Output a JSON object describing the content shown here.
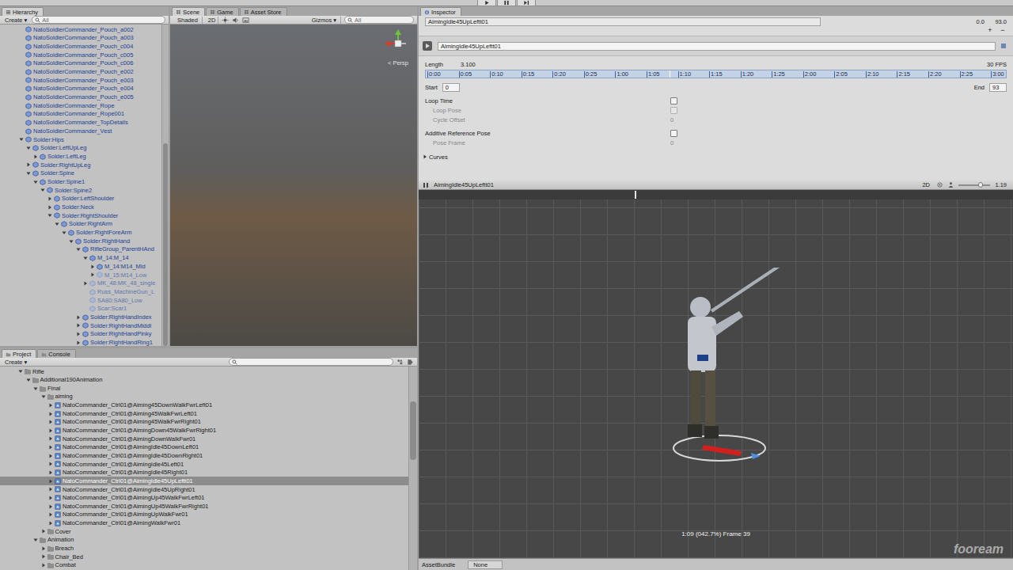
{
  "hierarchy": {
    "tab": "Hierarchy",
    "create": "Create ▾",
    "search": "All",
    "scrollbar": {
      "offset": 0.37,
      "size": 0.63
    },
    "items": [
      {
        "label": "NatoSoldierCommander_Pouch_a002",
        "depth": 1,
        "has_children": false,
        "expanded": false,
        "active": true
      },
      {
        "label": "NatoSoldierCommander_Pouch_a003",
        "depth": 1,
        "has_children": false,
        "expanded": false,
        "active": true
      },
      {
        "label": "NatoSoldierCommander_Pouch_c004",
        "depth": 1,
        "has_children": false,
        "expanded": false,
        "active": true
      },
      {
        "label": "NatoSoldierCommander_Pouch_c005",
        "depth": 1,
        "has_children": false,
        "expanded": false,
        "active": true
      },
      {
        "label": "NatoSoldierCommander_Pouch_c006",
        "depth": 1,
        "has_children": false,
        "expanded": false,
        "active": true
      },
      {
        "label": "NatoSoldierCommander_Pouch_e002",
        "depth": 1,
        "has_children": false,
        "expanded": false,
        "active": true
      },
      {
        "label": "NatoSoldierCommander_Pouch_e003",
        "depth": 1,
        "has_children": false,
        "expanded": false,
        "active": true
      },
      {
        "label": "NatoSoldierCommander_Pouch_e004",
        "depth": 1,
        "has_children": false,
        "expanded": false,
        "active": true
      },
      {
        "label": "NatoSoldierCommander_Pouch_e005",
        "depth": 1,
        "has_children": false,
        "expanded": false,
        "active": true
      },
      {
        "label": "NatoSoldierCommander_Rope",
        "depth": 1,
        "has_children": false,
        "expanded": false,
        "active": true
      },
      {
        "label": "NatoSoldierCommander_Rope001",
        "depth": 1,
        "has_children": false,
        "expanded": false,
        "active": true
      },
      {
        "label": "NatoSoldierCommander_TopDetails",
        "depth": 1,
        "has_children": false,
        "expanded": false,
        "active": true
      },
      {
        "label": "NatoSoldierCommander_Vest",
        "depth": 1,
        "has_children": false,
        "expanded": false,
        "active": true
      },
      {
        "label": "Solder:Hips",
        "depth": 1,
        "has_children": true,
        "expanded": true,
        "active": true
      },
      {
        "label": "Solder:LeftUpLeg",
        "depth": 2,
        "has_children": true,
        "expanded": true,
        "active": true
      },
      {
        "label": "Solder:LeftLeg",
        "depth": 3,
        "has_children": true,
        "expanded": false,
        "active": true
      },
      {
        "label": "Solder:RightUpLeg",
        "depth": 2,
        "has_children": true,
        "expanded": false,
        "active": true
      },
      {
        "label": "Solder:Spine",
        "depth": 2,
        "has_children": true,
        "expanded": true,
        "active": true
      },
      {
        "label": "Solder:Spine1",
        "depth": 3,
        "has_children": true,
        "expanded": true,
        "active": true
      },
      {
        "label": "Solder:Spine2",
        "depth": 4,
        "has_children": true,
        "expanded": true,
        "active": true
      },
      {
        "label": "Solder:LeftShoulder",
        "depth": 5,
        "has_children": true,
        "expanded": false,
        "active": true
      },
      {
        "label": "Solder:Neck",
        "depth": 5,
        "has_children": true,
        "expanded": false,
        "active": true
      },
      {
        "label": "Solder:RightShoulder",
        "depth": 5,
        "has_children": true,
        "expanded": true,
        "active": true
      },
      {
        "label": "Solder:RightArm",
        "depth": 6,
        "has_children": true,
        "expanded": true,
        "active": true
      },
      {
        "label": "Solder:RightForeArm",
        "depth": 7,
        "has_children": true,
        "expanded": true,
        "active": true
      },
      {
        "label": "Solder:RightHand",
        "depth": 8,
        "has_children": true,
        "expanded": true,
        "active": true
      },
      {
        "label": "RifleGroup_ParentHAnd",
        "depth": 9,
        "has_children": true,
        "expanded": true,
        "active": true
      },
      {
        "label": "M_14:M_14",
        "depth": 10,
        "has_children": true,
        "expanded": true,
        "active": true
      },
      {
        "label": "M_14:M14_Mid",
        "depth": 11,
        "has_children": true,
        "expanded": false,
        "active": true
      },
      {
        "label": "M_15:M14_Low",
        "depth": 11,
        "has_children": true,
        "expanded": false,
        "active": false
      },
      {
        "label": "MK_48:MK_48_single",
        "depth": 10,
        "has_children": true,
        "expanded": false,
        "active": false
      },
      {
        "label": "Russ_MachineGun_L",
        "depth": 10,
        "has_children": false,
        "expanded": false,
        "active": false
      },
      {
        "label": "SA80:SA80_Low",
        "depth": 10,
        "has_children": false,
        "expanded": false,
        "active": false
      },
      {
        "label": "Scar:Scar1",
        "depth": 10,
        "has_children": false,
        "expanded": false,
        "active": false
      },
      {
        "label": "Solder:RightHandIndex",
        "depth": 9,
        "has_children": true,
        "expanded": false,
        "active": true
      },
      {
        "label": "Solder:RightHandMiddl",
        "depth": 9,
        "has_children": true,
        "expanded": false,
        "active": true
      },
      {
        "label": "Solder:RightHandPinky",
        "depth": 9,
        "has_children": true,
        "expanded": false,
        "active": true
      },
      {
        "label": "Solder:RightHandRing1",
        "depth": 9,
        "has_children": true,
        "expanded": false,
        "active": true
      }
    ]
  },
  "scene": {
    "tabs": [
      {
        "label": "Scene",
        "selected": true
      },
      {
        "label": "Game",
        "selected": false
      },
      {
        "label": "Asset Store",
        "selected": false
      }
    ],
    "shading": "Shaded",
    "mode_2d": "2D",
    "gizmos": "Gizmos ▾",
    "search": "All",
    "persp": "< Persp"
  },
  "inspector": {
    "tab": "Inspector",
    "name": "AimingIdle45UpLeftt01",
    "range_start": "0.0",
    "range_end": "93.0",
    "add": "+",
    "remove": "−",
    "clip_name": "AimingIdle45UpLeftt01",
    "length_label": "Length",
    "length": "3.100",
    "fps": "30 FPS",
    "ticks": [
      "0:00",
      "0:05",
      "0:10",
      "0:15",
      "0:20",
      "0:25",
      "1:00",
      "1:05",
      "1:10",
      "1:15",
      "1:20",
      "1:25",
      "2:00",
      "2:05",
      "2:10",
      "2:15",
      "2:20",
      "2:25",
      "3:00"
    ],
    "playhead": 0.42,
    "start_label": "Start",
    "start": "0",
    "end_label": "End",
    "end": "93",
    "settings": [
      {
        "label": "Loop Time",
        "kind": "checkbox",
        "checked": false,
        "disabled": false,
        "value": ""
      },
      {
        "label": "Loop Pose",
        "kind": "checkbox",
        "checked": false,
        "disabled": true,
        "value": ""
      },
      {
        "label": "Cycle Offset",
        "kind": "number",
        "checked": false,
        "disabled": true,
        "value": "0"
      },
      {
        "label": "Additive Reference Pose",
        "kind": "checkbox",
        "checked": false,
        "disabled": false,
        "value": ""
      },
      {
        "label": "Pose Frame",
        "kind": "number",
        "checked": false,
        "disabled": true,
        "value": "0"
      }
    ],
    "curves": {
      "label": "Curves",
      "expanded": false
    }
  },
  "preview": {
    "title": "AimingIdle45UpLeftt01",
    "mode_2d": "2D",
    "speed": "1.19",
    "speed_level": 0.7,
    "playhead": 0.42,
    "status": "1:09 (042.7%) Frame 39",
    "watermark": "fooream"
  },
  "asset_bundle": {
    "label": "AssetBundle",
    "value": "None"
  },
  "project": {
    "tabs": [
      {
        "label": "Project",
        "selected": true
      },
      {
        "label": "Console",
        "selected": false
      }
    ],
    "create": "Create ▾",
    "scrollbar": {
      "offset": 0.17,
      "size": 0.29
    },
    "items": [
      {
        "label": "Rifle",
        "depth": 0,
        "kind": "folder",
        "has_children": true,
        "expanded": true,
        "selected": false
      },
      {
        "label": "Additional190Animation",
        "depth": 1,
        "kind": "folder",
        "has_children": true,
        "expanded": true,
        "selected": false
      },
      {
        "label": "Final",
        "depth": 2,
        "kind": "folder",
        "has_children": true,
        "expanded": true,
        "selected": false
      },
      {
        "label": "aiming",
        "depth": 3,
        "kind": "folder",
        "has_children": true,
        "expanded": true,
        "selected": false
      },
      {
        "label": "NatoCommander_Ctrl01@Aiming45DownWalkFwrLeft01",
        "depth": 4,
        "kind": "asset",
        "has_children": true,
        "expanded": false,
        "selected": false
      },
      {
        "label": "NatoCommander_Ctrl01@Aiming45WalkFwrLeft01",
        "depth": 4,
        "kind": "asset",
        "has_children": true,
        "expanded": false,
        "selected": false
      },
      {
        "label": "NatoCommander_Ctrl01@Aiming45WalkFwrRight01",
        "depth": 4,
        "kind": "asset",
        "has_children": true,
        "expanded": false,
        "selected": false
      },
      {
        "label": "NatoCommander_Ctrl01@AimingDown45WalkFwrRight01",
        "depth": 4,
        "kind": "asset",
        "has_children": true,
        "expanded": false,
        "selected": false
      },
      {
        "label": "NatoCommander_Ctrl01@AimingDownWalkFwr01",
        "depth": 4,
        "kind": "asset",
        "has_children": true,
        "expanded": false,
        "selected": false
      },
      {
        "label": "NatoCommander_Ctrl01@AimingIdle45DownLeft01",
        "depth": 4,
        "kind": "asset",
        "has_children": true,
        "expanded": false,
        "selected": false
      },
      {
        "label": "NatoCommander_Ctrl01@AimingIdle45DownRight01",
        "depth": 4,
        "kind": "asset",
        "has_children": true,
        "expanded": false,
        "selected": false
      },
      {
        "label": "NatoCommander_Ctrl01@AimingIdle45Left01",
        "depth": 4,
        "kind": "asset",
        "has_children": true,
        "expanded": false,
        "selected": false
      },
      {
        "label": "NatoCommander_Ctrl01@AimingIdle45Right01",
        "depth": 4,
        "kind": "asset",
        "has_children": true,
        "expanded": false,
        "selected": false
      },
      {
        "label": "NatoCommander_Ctrl01@AimingIdle45UpLeftt01",
        "depth": 4,
        "kind": "asset",
        "has_children": true,
        "expanded": false,
        "selected": true
      },
      {
        "label": "NatoCommander_Ctrl01@AimingIdle45UpRight01",
        "depth": 4,
        "kind": "asset",
        "has_children": true,
        "expanded": false,
        "selected": false
      },
      {
        "label": "NatoCommander_Ctrl01@AimingUp45WalkFwrLeft01",
        "depth": 4,
        "kind": "asset",
        "has_children": true,
        "expanded": false,
        "selected": false
      },
      {
        "label": "NatoCommander_Ctrl01@AimingUp45WalkFwrRight01",
        "depth": 4,
        "kind": "asset",
        "has_children": true,
        "expanded": false,
        "selected": false
      },
      {
        "label": "NatoCommander_Ctrl01@AimingUpWalkFwr01",
        "depth": 4,
        "kind": "asset",
        "has_children": true,
        "expanded": false,
        "selected": false
      },
      {
        "label": "NatoCommander_Ctrl01@AimingWalkFwr01",
        "depth": 4,
        "kind": "asset",
        "has_children": true,
        "expanded": false,
        "selected": false
      },
      {
        "label": "Cover",
        "depth": 3,
        "kind": "folder",
        "has_children": true,
        "expanded": false,
        "selected": false
      },
      {
        "label": "Animation",
        "depth": 2,
        "kind": "folder",
        "has_children": true,
        "expanded": true,
        "selected": false
      },
      {
        "label": "Breach",
        "depth": 3,
        "kind": "folder",
        "has_children": true,
        "expanded": false,
        "selected": false
      },
      {
        "label": "Chair_Bed",
        "depth": 3,
        "kind": "folder",
        "has_children": true,
        "expanded": false,
        "selected": false
      },
      {
        "label": "Combat",
        "depth": 3,
        "kind": "folder",
        "has_children": true,
        "expanded": false,
        "selected": false
      }
    ]
  }
}
